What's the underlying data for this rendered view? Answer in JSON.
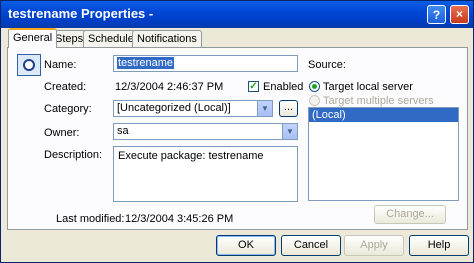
{
  "window": {
    "title": "testrename Properties -",
    "help_glyph": "?",
    "close_glyph": "×"
  },
  "tabs": [
    {
      "label": "General",
      "active": true
    },
    {
      "label": "Steps",
      "active": false
    },
    {
      "label": "Schedules",
      "active": false
    },
    {
      "label": "Notifications",
      "active": false
    }
  ],
  "form": {
    "name_label": "Name:",
    "name_value": "testrename",
    "created_label": "Created:",
    "created_value": "12/3/2004 2:46:37 PM",
    "enabled_label": "Enabled",
    "enabled_checked": true,
    "category_label": "Category:",
    "category_value": "[Uncategorized (Local)]",
    "category_browse": "...",
    "owner_label": "Owner:",
    "owner_value": "sa",
    "description_label": "Description:",
    "description_value": "Execute package: testrename",
    "last_modified_label": "Last modified:",
    "last_modified_value": "12/3/2004 3:45:26 PM"
  },
  "source": {
    "label": "Source:",
    "target_local": "Target local server",
    "target_multiple": "Target multiple servers",
    "servers": [
      "(Local)"
    ],
    "change_button": "Change..."
  },
  "buttons": {
    "ok": "OK",
    "cancel": "Cancel",
    "apply": "Apply",
    "help": "Help"
  },
  "colors": {
    "titlebar": "#0054e3",
    "selection": "#316ac5",
    "dialog": "#ece9d8",
    "panel": "#fcfcfe"
  }
}
